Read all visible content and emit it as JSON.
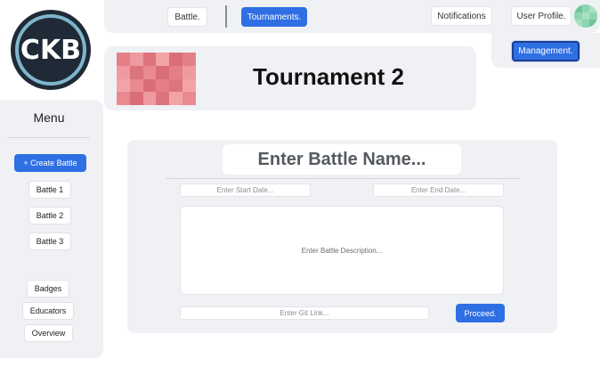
{
  "logo": {
    "text": "CKB"
  },
  "header": {
    "tabs": [
      {
        "label": "Battle."
      },
      {
        "label": "Tournaments.",
        "active": true
      }
    ],
    "notifications_label": "Notifications",
    "profile_label": "User Profile.",
    "management_label": "Management."
  },
  "sidebar": {
    "title": "Menu",
    "create_label": "+ Create Battle",
    "battles": [
      {
        "label": "Battle 1"
      },
      {
        "label": "Battle 2"
      },
      {
        "label": "Battle 3"
      }
    ],
    "links": [
      {
        "label": "Badges"
      },
      {
        "label": "Educators"
      },
      {
        "label": "Overview"
      }
    ]
  },
  "banner": {
    "title": "Tournament 2"
  },
  "form": {
    "name_placeholder": "Enter Battle Name...",
    "start_date_placeholder": "Enter Start Date...",
    "end_date_placeholder": "Enter End Date...",
    "description_placeholder": "Enter Battle Description...",
    "git_link_placeholder": "Enter Git Link...",
    "proceed_label": "Proceed."
  },
  "colors": {
    "accent": "#2f6fe4",
    "panel": "#f0f1f5",
    "thumbnail": "#e8868c"
  }
}
